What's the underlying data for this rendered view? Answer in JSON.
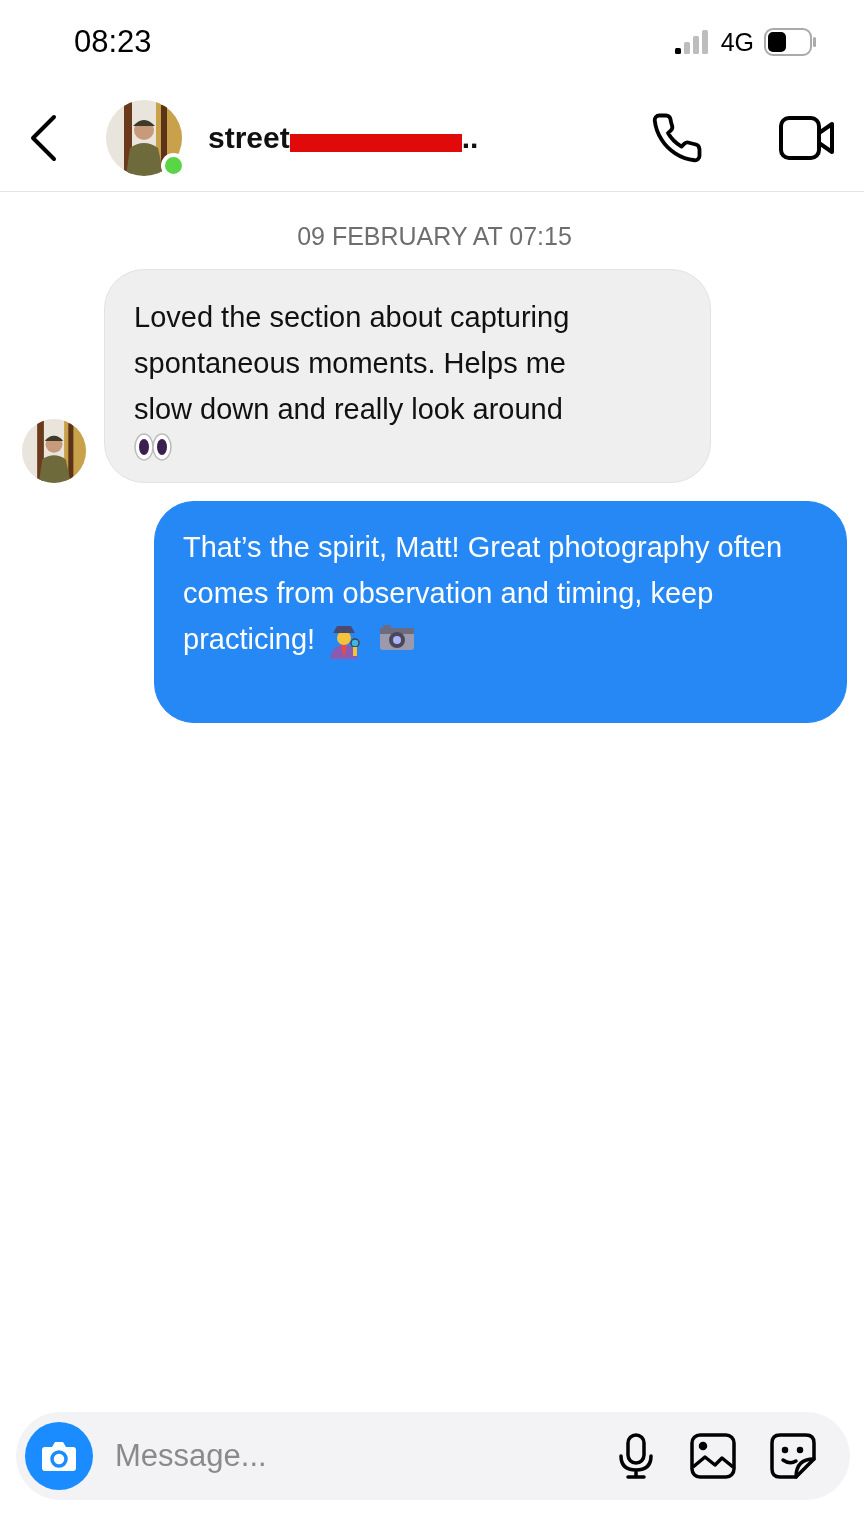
{
  "status_bar": {
    "time": "08:23",
    "network": "4G"
  },
  "header": {
    "name": "street",
    "name_tail": "..",
    "redacted": true,
    "online": true
  },
  "date_divider": "09 FEBRUARY AT 07:15",
  "messages": [
    {
      "kind": "received",
      "text": "Loved the section about capturing spontaneous moments. Helps me slow down and really look around",
      "emoji": [
        {
          "kind": "eyes"
        }
      ]
    },
    {
      "kind": "sent",
      "text": "That’s the spirit, Matt! Great photography often comes from observation and timing, keep practicing!",
      "emoji": [
        {
          "kind": "detective"
        },
        {
          "kind": "camera"
        }
      ]
    }
  ],
  "composer": {
    "placeholder": "Message..."
  }
}
